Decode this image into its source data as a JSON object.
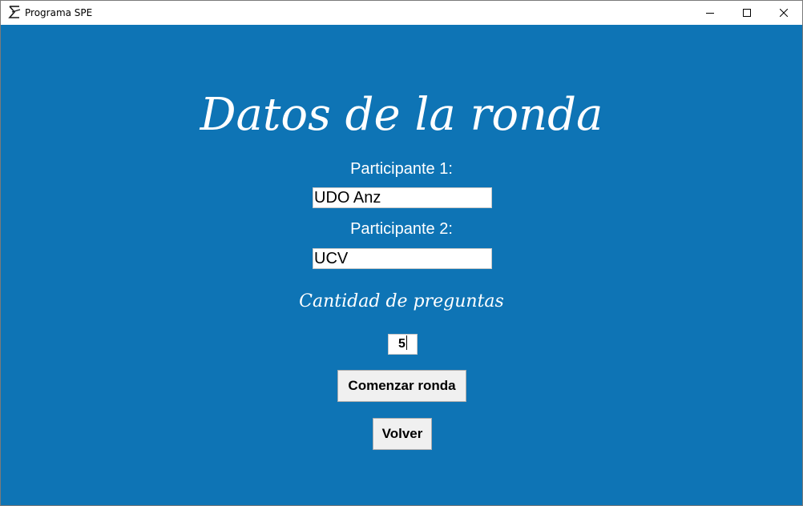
{
  "window": {
    "title": "Programa SPE",
    "background_color": "#0e74b5",
    "controls": {
      "minimize_icon": "minimize-icon",
      "maximize_icon": "maximize-icon",
      "close_icon": "close-icon"
    }
  },
  "form": {
    "heading": "Datos de la ronda",
    "participant1_label": "Participante 1:",
    "participant1_value": "UDO Anz",
    "participant2_label": "Participante 2:",
    "participant2_value": "UCV",
    "question_count_label": "Cantidad de preguntas",
    "question_count_value": "5",
    "start_button": "Comenzar ronda",
    "back_button": "Volver"
  }
}
